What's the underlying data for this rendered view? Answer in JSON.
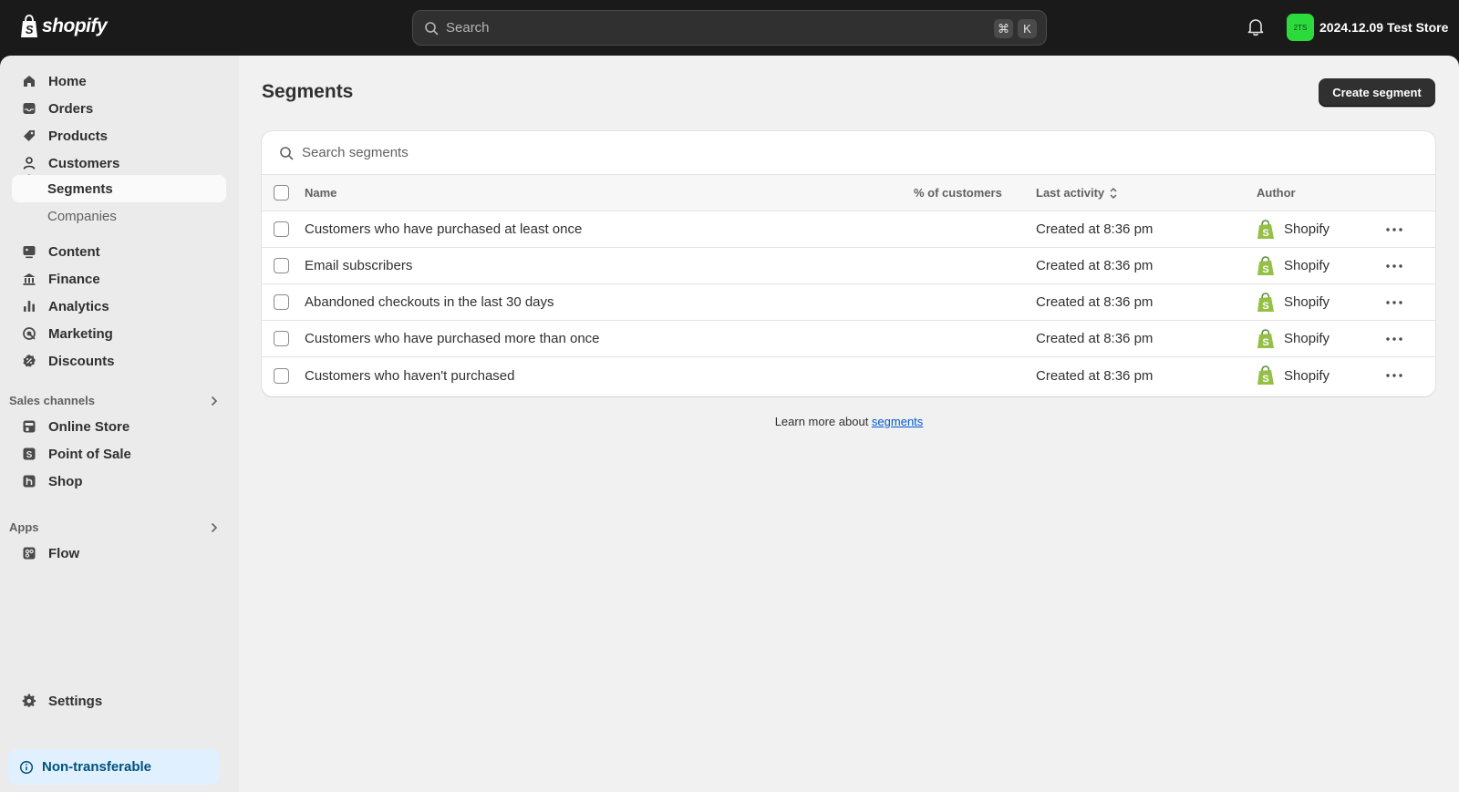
{
  "topbar": {
    "logo_text": "shopify",
    "search_placeholder": "Search",
    "shortcut_cmd": "⌘",
    "shortcut_key": "K",
    "store_initials": "2TS",
    "store_name": "2024.12.09 Test Store",
    "avatar_color": "#2bdb3c"
  },
  "sidebar": {
    "items": [
      {
        "label": "Home",
        "icon": "home-icon"
      },
      {
        "label": "Orders",
        "icon": "inbox-icon"
      },
      {
        "label": "Products",
        "icon": "tag-icon"
      },
      {
        "label": "Customers",
        "icon": "person-icon"
      },
      {
        "label": "Segments"
      },
      {
        "label": "Companies"
      },
      {
        "label": "Content",
        "icon": "content-icon"
      },
      {
        "label": "Finance",
        "icon": "bank-icon"
      },
      {
        "label": "Analytics",
        "icon": "bar-chart-icon"
      },
      {
        "label": "Marketing",
        "icon": "target-icon"
      },
      {
        "label": "Discounts",
        "icon": "discount-icon"
      }
    ],
    "sales_channels_label": "Sales channels",
    "sales_channels": [
      {
        "label": "Online Store",
        "icon": "store-icon"
      },
      {
        "label": "Point of Sale",
        "icon": "pos-icon"
      },
      {
        "label": "Shop",
        "icon": "shop-icon"
      }
    ],
    "apps_label": "Apps",
    "apps": [
      {
        "label": "Flow",
        "icon": "flow-icon"
      }
    ],
    "settings_label": "Settings",
    "non_transferable_label": "Non-transferable"
  },
  "main": {
    "title": "Segments",
    "create_button": "Create segment",
    "search_placeholder": "Search segments",
    "columns": {
      "name": "Name",
      "percent": "% of customers",
      "last_activity": "Last activity",
      "author": "Author"
    },
    "rows": [
      {
        "name": "Customers who have purchased at least once",
        "percent": "",
        "last_activity": "Created at 8:36 pm",
        "author": "Shopify"
      },
      {
        "name": "Email subscribers",
        "percent": "",
        "last_activity": "Created at 8:36 pm",
        "author": "Shopify"
      },
      {
        "name": "Abandoned checkouts in the last 30 days",
        "percent": "",
        "last_activity": "Created at 8:36 pm",
        "author": "Shopify"
      },
      {
        "name": "Customers who have purchased more than once",
        "percent": "",
        "last_activity": "Created at 8:36 pm",
        "author": "Shopify"
      },
      {
        "name": "Customers who haven't purchased",
        "percent": "",
        "last_activity": "Created at 8:36 pm",
        "author": "Shopify"
      }
    ],
    "learn_more_prefix": "Learn more about ",
    "learn_more_link": "segments"
  },
  "colors": {
    "primary_button": "#303030",
    "link": "#005bd3",
    "shopify_green": "#95bf47",
    "non_transferable_bg": "#e0f0ff"
  }
}
